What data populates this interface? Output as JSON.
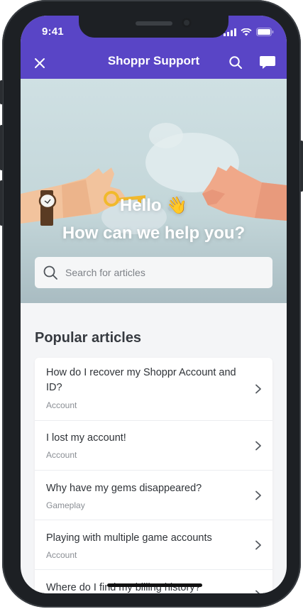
{
  "status": {
    "time": "9:41"
  },
  "header": {
    "title": "Shoppr Support"
  },
  "hero": {
    "greeting": "Hello 👋",
    "subtitle": "How can we help you?"
  },
  "search": {
    "placeholder": "Search for articles"
  },
  "popular": {
    "title": "Popular articles",
    "articles": [
      {
        "title": "How do I recover my Shoppr Account and ID?",
        "category": "Account"
      },
      {
        "title": "I lost my account!",
        "category": "Account"
      },
      {
        "title": "Why have my gems disappeared?",
        "category": "Gameplay"
      },
      {
        "title": "Playing with multiple game accounts",
        "category": "Account"
      },
      {
        "title": "Where do I find my billing history?",
        "category": ""
      }
    ]
  },
  "colors": {
    "brand": "#5945c6"
  }
}
